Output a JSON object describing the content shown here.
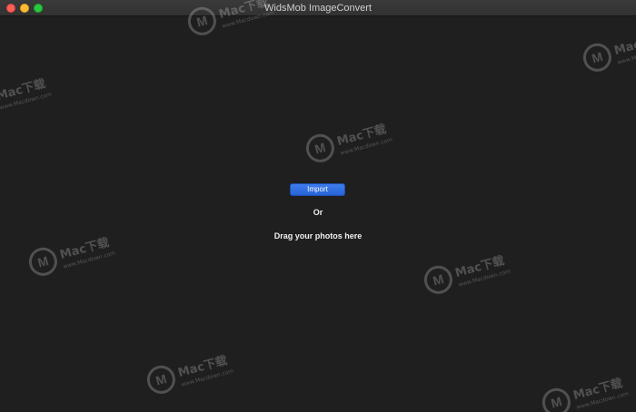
{
  "window": {
    "title": "WidsMob ImageConvert"
  },
  "main": {
    "import_label": "Import",
    "or_label": "Or",
    "drag_label": "Drag your photos here"
  },
  "watermark": {
    "brand_text": "Mac下载",
    "site_text": "www.Macdown.com"
  },
  "colors": {
    "background": "#1f1f1f",
    "accent": "#2f6fe6",
    "text": "#f0f0f0"
  }
}
